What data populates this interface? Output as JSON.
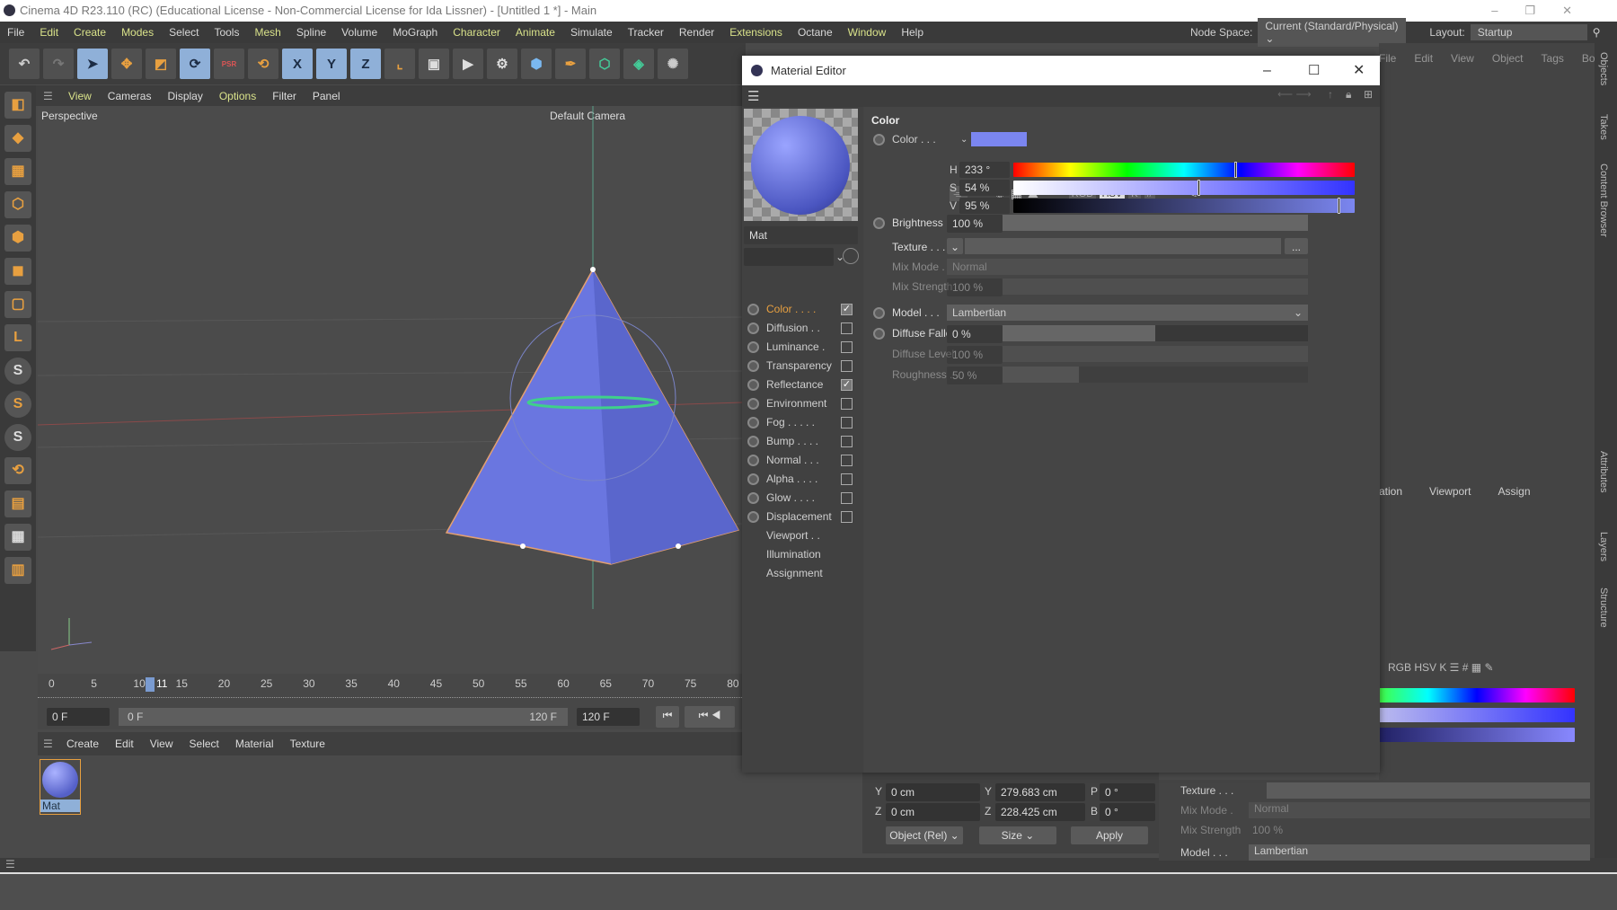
{
  "window": {
    "title": "Cinema 4D R23.110 (RC) (Educational License - Non-Commercial License for Ida Lissner) - [Untitled 1 *] - Main"
  },
  "menu": [
    "File",
    "Edit",
    "Create",
    "Modes",
    "Select",
    "Tools",
    "Mesh",
    "Spline",
    "Volume",
    "MoGraph",
    "Character",
    "Animate",
    "Simulate",
    "Tracker",
    "Render",
    "Extensions",
    "Octane",
    "Window",
    "Help"
  ],
  "menu_highlight": [
    "Edit",
    "Create",
    "Modes",
    "Mesh",
    "Character",
    "Animate",
    "Extensions",
    "Window"
  ],
  "node_space": {
    "label": "Node Space:",
    "value": "Current (Standard/Physical)"
  },
  "layout": {
    "label": "Layout:",
    "value": "Startup"
  },
  "toolbar": {
    "x": "X",
    "y": "Y",
    "z": "Z",
    "psr": "PSR"
  },
  "object_manager_menu": [
    "File",
    "Edit",
    "View",
    "Object",
    "Tags",
    "Bookmarks"
  ],
  "side_tabs": [
    "Objects",
    "Takes",
    "Content Browser",
    "Attributes",
    "Layers",
    "Structure"
  ],
  "viewport": {
    "menu": [
      "View",
      "Cameras",
      "Display",
      "Options",
      "Filter",
      "Panel"
    ],
    "label": "Perspective",
    "camera": "Default Camera"
  },
  "timeline": {
    "ticks": [
      "0",
      "5",
      "10",
      "15",
      "20",
      "25",
      "30",
      "35",
      "40",
      "45",
      "50",
      "55",
      "60",
      "65",
      "70",
      "75",
      "80"
    ],
    "current": "11",
    "start": "0 F",
    "range_start": "0 F",
    "range_end": "120 F",
    "end": "120 F"
  },
  "material_manager": {
    "menu": [
      "Create",
      "Edit",
      "View",
      "Select",
      "Material",
      "Texture"
    ],
    "material_name": "Mat"
  },
  "coordinates": {
    "y_pos": "0 cm",
    "z_pos": "0 cm",
    "y_size": "279.683 cm",
    "z_size": "228.425 cm",
    "p_rot": "0 °",
    "b_rot": "0 °",
    "labels": {
      "y": "Y",
      "z": "Z",
      "p": "P",
      "b": "B"
    },
    "mode": "Object (Rel)",
    "size_mode": "Size",
    "apply": "Apply"
  },
  "attributes_behind": {
    "tabs": [
      "ation",
      "Viewport",
      "Assign"
    ],
    "texture": "Texture . . .",
    "mix_mode": "Mix Mode .",
    "mix_mode_value": "Normal",
    "mix_strength": "Mix Strength",
    "mix_strength_value": "100 %",
    "model": "Model . . .",
    "model_value": "Lambertian"
  },
  "material_editor": {
    "title": "Material Editor",
    "name": "Mat",
    "channels": [
      {
        "label": "Color . . . .",
        "checked": true,
        "active": true
      },
      {
        "label": "Diffusion . .",
        "checked": false
      },
      {
        "label": "Luminance .",
        "checked": false
      },
      {
        "label": "Transparency",
        "checked": false
      },
      {
        "label": "Reflectance",
        "checked": true
      },
      {
        "label": "Environment",
        "checked": false
      },
      {
        "label": "Fog . . . . .",
        "checked": false
      },
      {
        "label": "Bump . . . .",
        "checked": false
      },
      {
        "label": "Normal . . .",
        "checked": false
      },
      {
        "label": "Alpha . . . .",
        "checked": false
      },
      {
        "label": "Glow . . . .",
        "checked": false
      },
      {
        "label": "Displacement",
        "checked": false
      }
    ],
    "extra_items": [
      "Viewport . .",
      "Illumination",
      "Assignment"
    ],
    "section": "Color",
    "color_label": "Color . . .",
    "color_hex": "#7b86f0",
    "mode_buttons": [
      "RGB",
      "HSV",
      "K",
      "#"
    ],
    "active_mode": "HSV",
    "h": {
      "label": "H",
      "value": "233 °",
      "fraction": 0.647
    },
    "s": {
      "label": "S",
      "value": "54 %",
      "fraction": 0.54
    },
    "v": {
      "label": "V",
      "value": "95 %",
      "fraction": 0.95
    },
    "brightness": {
      "label": "Brightness .",
      "value": "100 %",
      "fraction": 1.0
    },
    "texture": {
      "label": "Texture . . .",
      "button": "..."
    },
    "mix_mode": {
      "label": "Mix Mode .",
      "value": "Normal"
    },
    "mix_strength": {
      "label": "Mix Strength",
      "value": "100 %"
    },
    "model": {
      "label": "Model . . .",
      "value": "Lambertian"
    },
    "diffuse_falloff": {
      "label": "Diffuse Falloff",
      "value": "0 %",
      "fraction": 0.5
    },
    "diffuse_level": {
      "label": "Diffuse Level",
      "value": "100 %"
    },
    "roughness": {
      "label": "Roughness .",
      "value": "50 %",
      "fraction": 0.25
    }
  },
  "colors": {
    "accent_orange": "#e8a040",
    "material_blue": "#6f7de8",
    "selection": "#8fb0d8"
  }
}
